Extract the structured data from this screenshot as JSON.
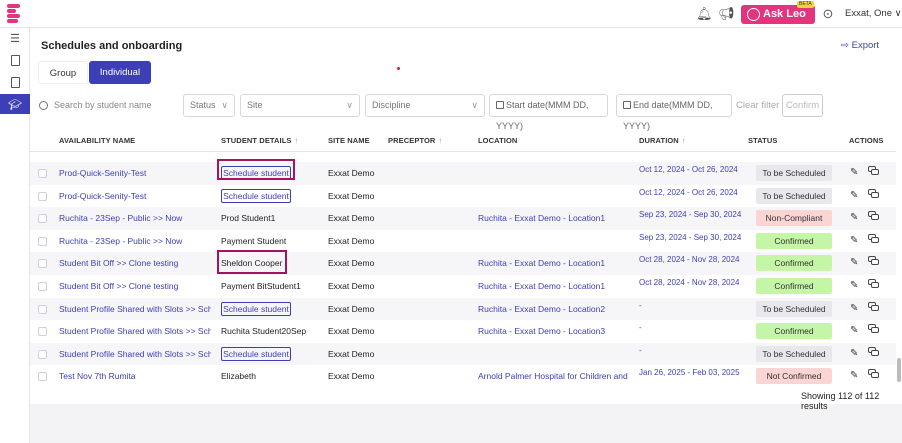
{
  "header": {
    "ask_leo": "Ask Leo",
    "beta": "BETA",
    "user": "Exxat, One ∨",
    "icons": [
      "bell-icon",
      "megaphone-icon",
      "help-icon"
    ]
  },
  "sidebar": {
    "icons": [
      "menu-icon",
      "document-icon",
      "document-list-icon",
      "graduation-cap-icon"
    ]
  },
  "page": {
    "title": "Schedules and onboarding",
    "export": "Export",
    "tabs": [
      "Group",
      "Individual"
    ]
  },
  "filters": {
    "search_placeholder": "Search by student name",
    "status": "Status",
    "site": "Site",
    "discipline": "Discipline",
    "start_date": "Start date(MMM DD, YYYY)",
    "end_date": "End date(MMM DD, YYYY)",
    "clear": "Clear filter",
    "confirm": "Confirm"
  },
  "table": {
    "headers": {
      "availability": "AVAILABILITY NAME",
      "student": "STUDENT DETAILS",
      "site": "SITE NAME",
      "preceptor": "PRECEPTOR",
      "location": "LOCATION",
      "duration": "DURATION",
      "status": "STATUS",
      "actions": "ACTIONS"
    },
    "sort_arrow": "↑",
    "schedule_label": "Schedule student",
    "rows": [
      {
        "name": "Prod-Quick-Senity-Test",
        "student": "",
        "site": "Exxat Demo",
        "location": "",
        "duration": "Oct 12, 2024 - Oct 26, 2024",
        "status": "To be Scheduled"
      },
      {
        "name": "Prod-Quick-Senity-Test",
        "student": "",
        "site": "Exxat Demo",
        "location": "",
        "duration": "Oct 12, 2024 - Oct 26, 2024",
        "status": "To be Scheduled"
      },
      {
        "name": "Ruchita - 23Sep - Public >> Now",
        "student": "Prod Student1",
        "site": "Exxat Demo",
        "location": "Ruchita - Exxat Demo - Location1",
        "duration": "Sep 23, 2024 - Sep 30, 2024",
        "status": "Non-Compliant"
      },
      {
        "name": "Ruchita - 23Sep - Public >> Now",
        "student": "Payment Student",
        "site": "Exxat Demo",
        "location": "",
        "duration": "Sep 23, 2024 - Sep 30, 2024",
        "status": "Confirmed"
      },
      {
        "name": "Student Bit Off >> Clone testing",
        "student": "Sheldon Cooper",
        "site": "Exxat Demo",
        "location": "Ruchita - Exxat Demo - Location1",
        "duration": "Oct 28, 2024 - Nov 28, 2024",
        "status": "Confirmed"
      },
      {
        "name": "Student Bit Off >> Clone testing",
        "student": "Payment BitStudent1",
        "site": "Exxat Demo",
        "location": "Ruchita - Exxat Demo - Location1",
        "duration": "Oct 28, 2024 - Nov 28, 2024",
        "status": "Confirmed"
      },
      {
        "name": "Student Profile Shared with Slots >> Scho...",
        "student": "",
        "site": "Exxat Demo",
        "location": "Ruchita - Exxat Demo - Location2",
        "duration": "-",
        "status": "To be Scheduled"
      },
      {
        "name": "Student Profile Shared with Slots >> Scho...",
        "student": "Ruchita Student20Sep",
        "site": "Exxat Demo",
        "location": "Ruchita - Exxat Demo - Location3",
        "duration": "-",
        "status": "Confirmed"
      },
      {
        "name": "Student Profile Shared with Slots >> Scho...",
        "student": "",
        "site": "Exxat Demo",
        "location": "",
        "duration": "-",
        "status": "To be Scheduled"
      },
      {
        "name": "Test Nov 7th Rumita",
        "student": "Elizabeth",
        "site": "Exxat Demo",
        "location": "Arnold Palmer Hospital for Children and ...",
        "duration": "Jan 26, 2025 - Feb 03, 2025",
        "status": "Not Confirmed"
      }
    ],
    "footer": "Showing 112 of 112 results"
  },
  "colors": {
    "brand": "#e2357d",
    "accent": "#3c3fb5",
    "confirmed": "#c5f5a6",
    "not_confirmed": "#fbd4d4",
    "to_be_scheduled": "#e8e8ec",
    "highlight": "#a3135f"
  }
}
